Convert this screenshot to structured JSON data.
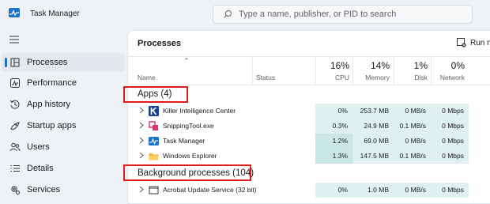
{
  "window": {
    "title": "Task Manager"
  },
  "search": {
    "placeholder": "Type a name, publisher, or PID to search"
  },
  "sidebar": {
    "items": [
      {
        "label": "Processes",
        "icon": "processes-icon",
        "active": true
      },
      {
        "label": "Performance",
        "icon": "performance-icon"
      },
      {
        "label": "App history",
        "icon": "history-icon"
      },
      {
        "label": "Startup apps",
        "icon": "startup-icon"
      },
      {
        "label": "Users",
        "icon": "users-icon"
      },
      {
        "label": "Details",
        "icon": "details-icon"
      },
      {
        "label": "Services",
        "icon": "services-icon"
      }
    ]
  },
  "main": {
    "title": "Processes",
    "run_task_label": "Run ne",
    "columns": {
      "name": "Name",
      "status": "Status",
      "cpu": {
        "pct": "16%",
        "label": "CPU"
      },
      "memory": {
        "pct": "14%",
        "label": "Memory"
      },
      "disk": {
        "pct": "1%",
        "label": "Disk"
      },
      "network": {
        "pct": "0%",
        "label": "Network"
      }
    },
    "groups": {
      "apps": "Apps (4)",
      "background": "Background processes (104)"
    },
    "apps": [
      {
        "name": "Killer Intelligence Center",
        "icon": "killer-icon",
        "cpu": "0%",
        "memory": "253.7 MB",
        "disk": "0 MB/s",
        "network": "0 Mbps"
      },
      {
        "name": "SnippingTool.exe",
        "icon": "snipping-tool-icon",
        "cpu": "0.3%",
        "memory": "24.9 MB",
        "disk": "0.1 MB/s",
        "network": "0 Mbps"
      },
      {
        "name": "Task Manager",
        "icon": "task-manager-icon",
        "cpu": "1.2%",
        "memory": "69.0 MB",
        "disk": "0 MB/s",
        "network": "0 Mbps"
      },
      {
        "name": "Windows Explorer",
        "icon": "folder-icon",
        "cpu": "1.3%",
        "memory": "147.5 MB",
        "disk": "0.1 MB/s",
        "network": "0 Mbps"
      }
    ],
    "background": [
      {
        "name": "Acrobat Update Service (32 bit)",
        "icon": "service-window-icon",
        "cpu": "0%",
        "memory": "1.0 MB",
        "disk": "0 MB/s",
        "network": "0 Mbps"
      }
    ]
  },
  "colors": {
    "highlight": "#e11b1b",
    "heat_light": "#dff1ef",
    "heat_mid": "#c9e7e4",
    "accent": "#1f6fc5"
  }
}
